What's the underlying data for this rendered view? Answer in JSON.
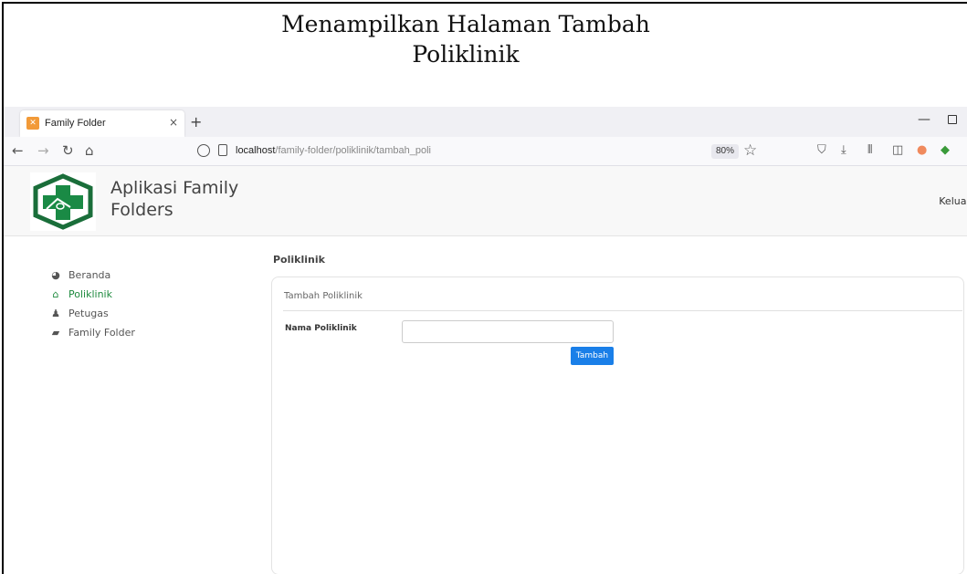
{
  "caption": {
    "line1": "Menampilkan Halaman Tambah",
    "line2": "Poliklinik"
  },
  "browser": {
    "tab": {
      "title": "Family Folder",
      "close_glyph": "×",
      "favicon": "xampp-icon"
    },
    "new_tab_glyph": "+",
    "url": {
      "host": "localhost",
      "path": "/family-folder/poliklinik/tambah_poli"
    },
    "zoom": "80%"
  },
  "header": {
    "title": "Aplikasi Family Folders",
    "logout_label": "Keluar"
  },
  "sidebar": {
    "items": [
      {
        "label": "Beranda",
        "icon": "dashboard-icon",
        "active": false
      },
      {
        "label": "Poliklinik",
        "icon": "home-icon",
        "active": true
      },
      {
        "label": "Petugas",
        "icon": "user-icon",
        "active": false
      },
      {
        "label": "Family Folder",
        "icon": "folder-icon",
        "active": false
      }
    ]
  },
  "main": {
    "section_title": "Poliklinik",
    "card_title": "Tambah Poliklinik",
    "form": {
      "label": "Nama Poliklinik",
      "value": "",
      "submit_label": "Tambah"
    }
  },
  "colors": {
    "accent_green": "#1e8a3e",
    "button_blue": "#1a7fe8"
  }
}
